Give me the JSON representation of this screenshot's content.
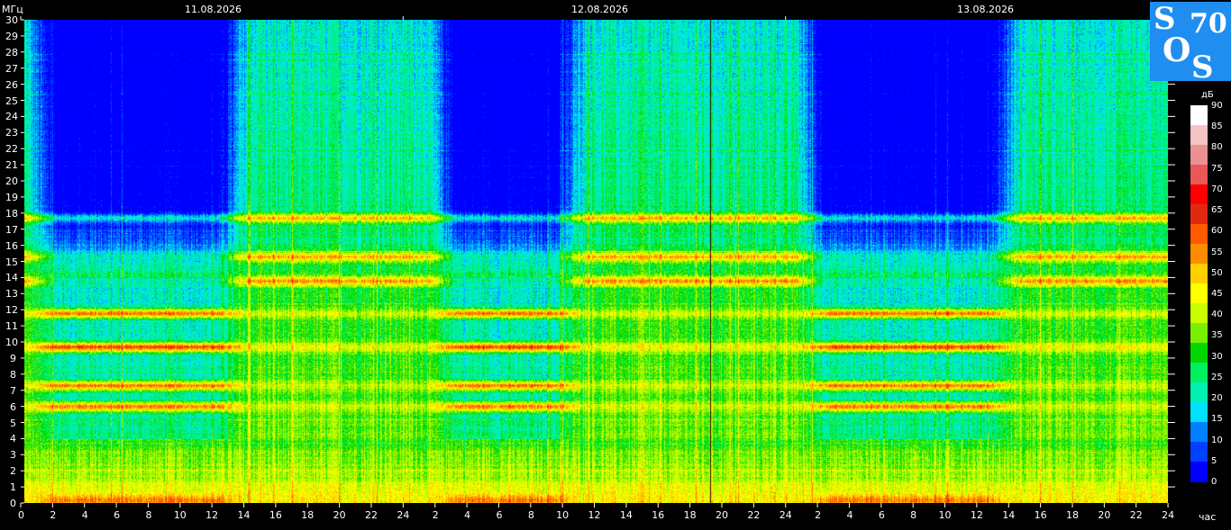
{
  "y_axis": {
    "unit": "МГц",
    "ticks": [
      "0",
      "1",
      "2",
      "3",
      "4",
      "5",
      "6",
      "7",
      "8",
      "9",
      "10",
      "11",
      "12",
      "13",
      "14",
      "15",
      "16",
      "17",
      "18",
      "19",
      "20",
      "21",
      "22",
      "23",
      "24",
      "25",
      "26",
      "27",
      "28",
      "29",
      "30"
    ]
  },
  "x_axis": {
    "unit": "час",
    "ticks": [
      "0",
      "2",
      "4",
      "6",
      "8",
      "10",
      "12",
      "14",
      "16",
      "18",
      "20",
      "22",
      "24",
      "2",
      "4",
      "6",
      "8",
      "10",
      "12",
      "14",
      "16",
      "18",
      "20",
      "22",
      "24",
      "2",
      "4",
      "6",
      "8",
      "10",
      "12",
      "14",
      "16",
      "18",
      "20",
      "22",
      "24"
    ]
  },
  "dates": [
    "11.08.2026",
    "12.08.2026",
    "13.08.2026"
  ],
  "colorbar": {
    "unit": "дБ",
    "ticks": [
      "90",
      "85",
      "80",
      "75",
      "70",
      "65",
      "60",
      "55",
      "50",
      "45",
      "40",
      "35",
      "30",
      "25",
      "20",
      "15",
      "10",
      "5",
      "0"
    ],
    "colors": [
      "#ffffff",
      "#f4c4c4",
      "#ec9090",
      "#e85858",
      "#ff0000",
      "#e02a10",
      "#ff5a00",
      "#ff8c00",
      "#ffd000",
      "#ffff00",
      "#c8ff00",
      "#78f000",
      "#00d800",
      "#00f060",
      "#00f0b0",
      "#00e0ff",
      "#0080ff",
      "#0040ff",
      "#0000ff"
    ]
  },
  "logo": {
    "s1": "S",
    "o": "O",
    "s2": "S",
    "num": "70"
  },
  "chart_data": {
    "type": "heatmap",
    "title": "",
    "xlabel": "час",
    "ylabel": "МГц",
    "zlabel": "дБ",
    "x_range_hours": [
      0,
      72
    ],
    "y_range_mhz": [
      0,
      30
    ],
    "z_range_db": [
      0,
      90
    ],
    "dates": [
      "11.08.2026",
      "12.08.2026",
      "13.08.2026"
    ],
    "persistent_bands_mhz": [
      {
        "freq": 0.2,
        "level_db": 60
      },
      {
        "freq": 1.0,
        "level_db": 45
      },
      {
        "freq": 6.0,
        "level_db": 62
      },
      {
        "freq": 7.3,
        "level_db": 62
      },
      {
        "freq": 9.7,
        "level_db": 68
      },
      {
        "freq": 11.8,
        "level_db": 63
      },
      {
        "freq": 13.8,
        "level_db": 58
      },
      {
        "freq": 15.3,
        "level_db": 56
      },
      {
        "freq": 17.7,
        "level_db": 55
      }
    ],
    "night_quiet_above_mhz": 16,
    "night_hours_local": [
      [
        2,
        12
      ],
      [
        27,
        33
      ],
      [
        50,
        60
      ]
    ],
    "data_gap_hour": 42.7
  }
}
